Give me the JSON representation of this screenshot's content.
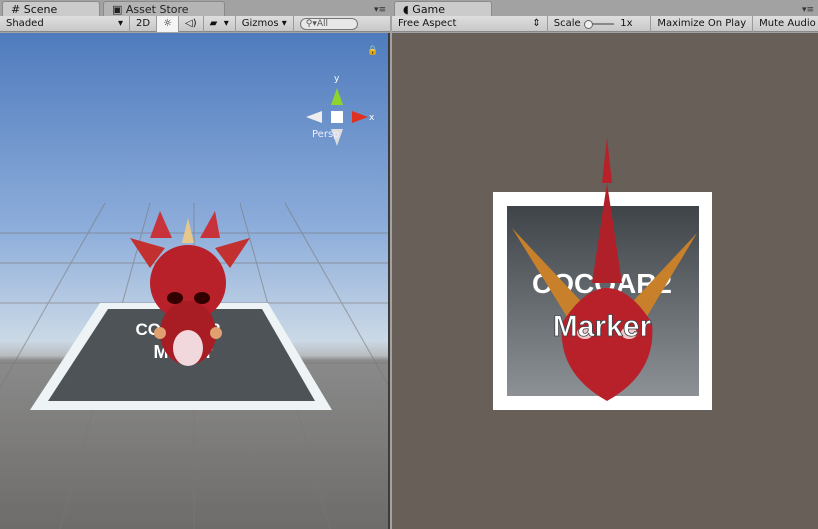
{
  "scene": {
    "tab": "Scene",
    "tab_icon": "grid-icon",
    "other_tab": "Asset Store",
    "other_tab_icon": "store-icon",
    "toolbar": {
      "draw_mode": "Shaded",
      "mode_2d": "2D",
      "gizmos": "Gizmos",
      "search_placeholder": "All"
    },
    "gizmo": {
      "y": "y",
      "x": "x",
      "projection": "Persp"
    },
    "marker_text": [
      "COCOAR2",
      "Marker"
    ]
  },
  "game": {
    "tab": "Game",
    "tab_icon": "pacman-icon",
    "toolbar": {
      "aspect": "Free Aspect",
      "scale_label": "Scale",
      "scale_value": "1x",
      "maximize": "Maximize On Play",
      "mute": "Mute Audio"
    },
    "marker_text": [
      "COCOAR2",
      "Marker"
    ]
  },
  "colors": {
    "dragon": "#b8202a",
    "game_bg": "#675f58"
  }
}
